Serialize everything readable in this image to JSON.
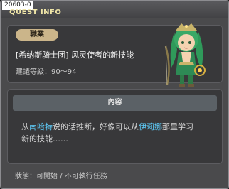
{
  "window": {
    "quest_id": "20603-0",
    "title": "QUEST INFO"
  },
  "quest": {
    "job_badge": "職業",
    "name": "[希纳斯骑士团] 风灵使者的新技能",
    "recommended_level": "建議等級：90～94"
  },
  "content": {
    "header": "內容",
    "desc_prefix": "从",
    "npc1": "南哈特",
    "desc_mid": "说的话推断，好像可以从",
    "npc2": "伊莉娜",
    "desc_line1_end": "那里学习",
    "desc_line2": "新的技能……"
  },
  "status": {
    "text": "狀態：可開始 / 不可執行任務"
  },
  "colors": {
    "title": "#f0e6a8",
    "highlight": "#5fd0ff",
    "badge": "#cbb58a"
  }
}
